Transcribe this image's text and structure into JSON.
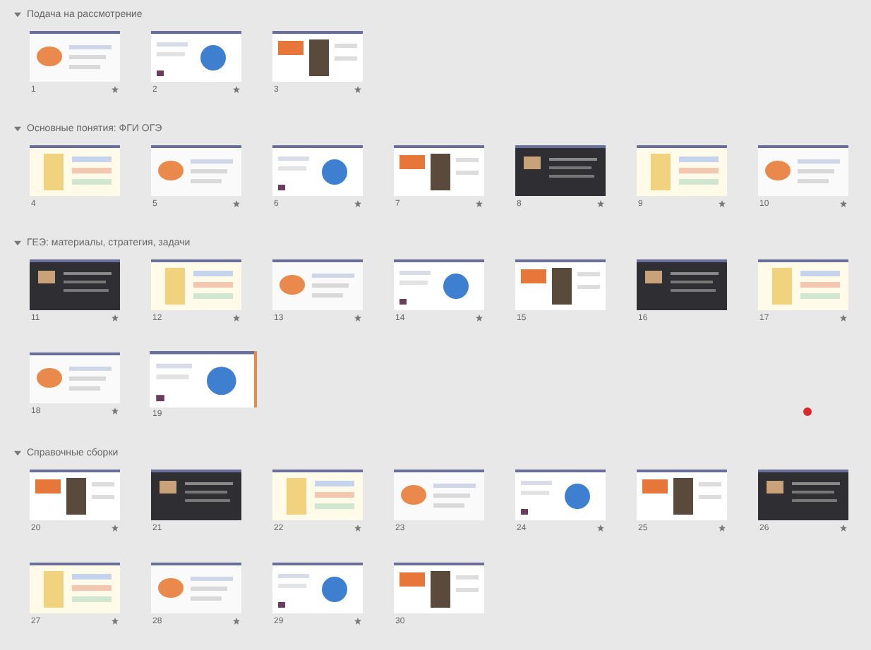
{
  "sections": [
    {
      "title": "Подача на рассмотрение",
      "expanded": true,
      "slides": [
        {
          "number": "1",
          "animated": true,
          "selected": false
        },
        {
          "number": "2",
          "animated": true,
          "selected": false
        },
        {
          "number": "3",
          "animated": true,
          "selected": false
        }
      ]
    },
    {
      "title": "Основные понятия: ФГИ ОГЭ",
      "expanded": true,
      "slides": [
        {
          "number": "4",
          "animated": false,
          "selected": false
        },
        {
          "number": "5",
          "animated": true,
          "selected": false
        },
        {
          "number": "6",
          "animated": true,
          "selected": false
        },
        {
          "number": "7",
          "animated": true,
          "selected": false
        },
        {
          "number": "8",
          "animated": true,
          "selected": false
        },
        {
          "number": "9",
          "animated": true,
          "selected": false
        },
        {
          "number": "10",
          "animated": true,
          "selected": false
        }
      ]
    },
    {
      "title": "ГЕЭ: материалы, стратегия, задачи",
      "expanded": true,
      "slides": [
        {
          "number": "11",
          "animated": true,
          "selected": false
        },
        {
          "number": "12",
          "animated": true,
          "selected": false
        },
        {
          "number": "13",
          "animated": true,
          "selected": false
        },
        {
          "number": "14",
          "animated": true,
          "selected": false
        },
        {
          "number": "15",
          "animated": false,
          "selected": false
        },
        {
          "number": "16",
          "animated": false,
          "selected": false
        },
        {
          "number": "17",
          "animated": true,
          "selected": false
        },
        {
          "number": "18",
          "animated": true,
          "selected": false
        },
        {
          "number": "19",
          "animated": false,
          "selected": true
        }
      ]
    },
    {
      "title": "Справочные сборки",
      "expanded": true,
      "slides": [
        {
          "number": "20",
          "animated": true,
          "selected": false
        },
        {
          "number": "21",
          "animated": false,
          "selected": false
        },
        {
          "number": "22",
          "animated": true,
          "selected": false
        },
        {
          "number": "23",
          "animated": false,
          "selected": false
        },
        {
          "number": "24",
          "animated": true,
          "selected": false
        },
        {
          "number": "25",
          "animated": true,
          "selected": false
        },
        {
          "number": "26",
          "animated": true,
          "selected": false
        },
        {
          "number": "27",
          "animated": true,
          "selected": false
        },
        {
          "number": "28",
          "animated": true,
          "selected": false
        },
        {
          "number": "29",
          "animated": true,
          "selected": false
        },
        {
          "number": "30",
          "animated": false,
          "selected": false
        }
      ]
    }
  ]
}
